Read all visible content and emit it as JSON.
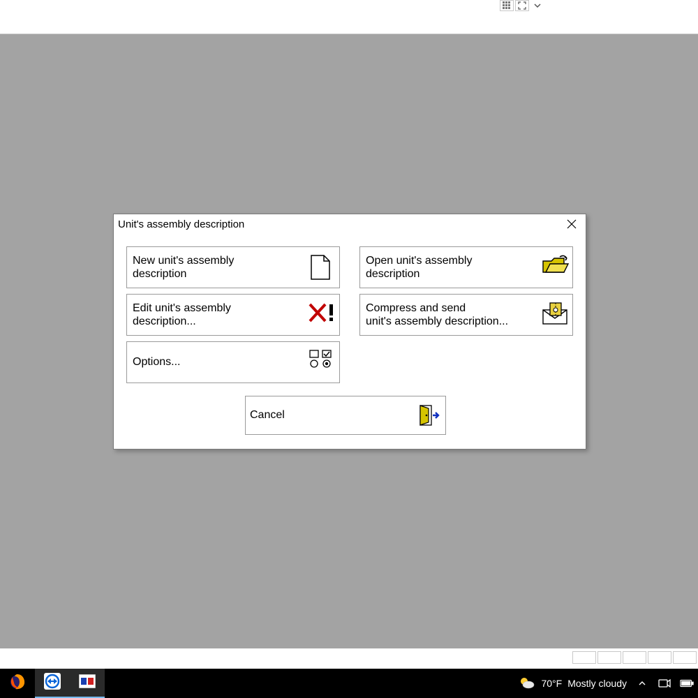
{
  "dialog": {
    "title": "Unit's assembly description",
    "buttons": {
      "new": "New unit's assembly\ndescription",
      "open": "Open unit's assembly\ndescription",
      "edit": "Edit unit's assembly\ndescription...",
      "compress": "Compress and send\nunit's assembly description...",
      "options": "Options...",
      "cancel": "Cancel"
    }
  },
  "taskbar": {
    "weather": {
      "temp": "70°F",
      "text": "Mostly cloudy"
    }
  }
}
